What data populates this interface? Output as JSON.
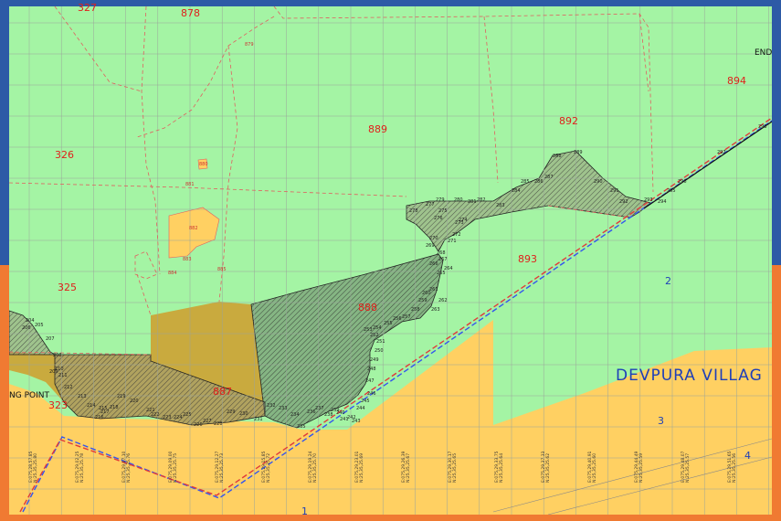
{
  "colors": {
    "frame_top": "#2d5aa6",
    "frame_bottom": "#f07a32",
    "green_land": "#a4f4a4",
    "yellow_land": "#ffd062",
    "olive_land": "#c9aa3e",
    "hatch_fill": "#8c8c6e",
    "plot_boundary": "#e06060",
    "grid": "#9aa49a",
    "route_blue": "#3355ee",
    "route_red": "#e03b3b"
  },
  "map": {
    "plot_numbers": [
      "327",
      "878",
      "326",
      "889",
      "892",
      "894",
      "325",
      "888",
      "893",
      "323",
      "887"
    ],
    "point_numbers": [
      "204",
      "205",
      "206",
      "207",
      "208",
      "209",
      "210",
      "211",
      "212",
      "213",
      "214",
      "215",
      "216",
      "217",
      "218",
      "219",
      "220",
      "221",
      "222",
      "223",
      "224",
      "225",
      "226",
      "227",
      "228",
      "229",
      "230",
      "231",
      "232",
      "233",
      "234",
      "235",
      "236",
      "237",
      "238",
      "239",
      "240",
      "241",
      "242",
      "243",
      "244",
      "245",
      "246",
      "247",
      "248",
      "249",
      "250",
      "251",
      "252",
      "253",
      "254",
      "255",
      "256",
      "257",
      "258",
      "259",
      "260",
      "261",
      "262",
      "263",
      "264",
      "265",
      "266",
      "267",
      "268",
      "269",
      "270",
      "271",
      "272",
      "273",
      "274",
      "275",
      "276",
      "277",
      "278",
      "279",
      "280",
      "281",
      "282",
      "283",
      "284",
      "285",
      "286",
      "287",
      "288",
      "289",
      "290",
      "291",
      "292",
      "293",
      "294",
      "295",
      "296",
      "297",
      "298"
    ],
    "small_parcels": [
      "879",
      "880",
      "881",
      "882",
      "883",
      "884",
      "885"
    ],
    "village_label": "DEVPURA VILLAG",
    "side_label": "NG POINT",
    "end_label": "END",
    "route_markers": [
      "1",
      "2",
      "3",
      "4"
    ],
    "coord_ticks": [
      [
        "E:075,28,57.85",
        "N:25,35,25.80"
      ],
      [
        "E:075,29,02.25",
        "N:25,35,25.78"
      ],
      [
        "E:075,29,07.10",
        "N:25,35,25.76"
      ],
      [
        "E:075,29,09.00",
        "N:25,35,25.75"
      ],
      [
        "E:075,29,12.27",
        "N:25,35,25.73"
      ],
      [
        "E:075,29,15.85",
        "N:25,35,25.72"
      ],
      [
        "E:075,29,19.24",
        "N:25,35,25.70"
      ],
      [
        "E:075,29,23.01",
        "N:25,35,25.69"
      ],
      [
        "E:075,29,26.39",
        "N:25,35,25.67"
      ],
      [
        "E:075,29,30.17",
        "N:25,35,25.65"
      ],
      [
        "E:075,29,33.75",
        "N:25,35,25.64"
      ],
      [
        "E:075,29,37.33",
        "N:25,35,25.62"
      ],
      [
        "E:075,29,40.91",
        "N:25,35,25.60"
      ],
      [
        "E:075,29,44.49",
        "N:25,35,25.59"
      ],
      [
        "E:075,29,48.07",
        "N:25,35,25.57"
      ],
      [
        "E:075,29,51.65",
        "N:25,35,25.56"
      ]
    ]
  }
}
